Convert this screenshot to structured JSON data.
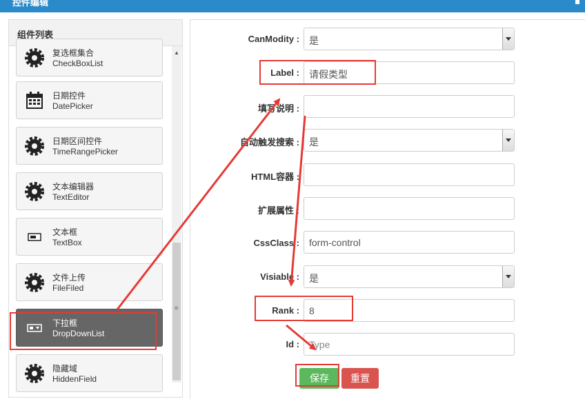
{
  "window": {
    "title": "控件编辑"
  },
  "sidebar": {
    "header": "组件列表",
    "items": [
      {
        "name": "复选框集合",
        "type": "CheckBoxList",
        "icon": "gear-icon"
      },
      {
        "name": "日期控件",
        "type": "DatePicker",
        "icon": "calendar-icon"
      },
      {
        "name": "日期区间控件",
        "type": "TimeRangePicker",
        "icon": "gear-icon"
      },
      {
        "name": "文本编辑器",
        "type": "TextEditor",
        "icon": "gear-icon"
      },
      {
        "name": "文本框",
        "type": "TextBox",
        "icon": "textbox-icon"
      },
      {
        "name": "文件上传",
        "type": "FileFiled",
        "icon": "gear-icon"
      },
      {
        "name": "下拉框",
        "type": "DropDownList",
        "icon": "dropdown-icon",
        "selected": true
      },
      {
        "name": "隐藏域",
        "type": "HiddenField",
        "icon": "gear-icon"
      }
    ]
  },
  "form": {
    "fields": [
      {
        "label": "CanModity :",
        "value": "是",
        "kind": "select"
      },
      {
        "label": "Label :",
        "value": "请假类型",
        "kind": "input"
      },
      {
        "label": "填写说明 :",
        "value": "",
        "kind": "input"
      },
      {
        "label": "自动触发搜索 :",
        "value": "是",
        "kind": "select"
      },
      {
        "label": "HTML容器 :",
        "value": "",
        "kind": "input"
      },
      {
        "label": "扩展属性 :",
        "value": "",
        "kind": "input"
      },
      {
        "label": "CssClass :",
        "value": "form-control",
        "kind": "input"
      },
      {
        "label": "Visiable :",
        "value": "是",
        "kind": "select"
      },
      {
        "label": "Rank :",
        "value": "8",
        "kind": "input"
      },
      {
        "label": "Id :",
        "value": "Type",
        "kind": "input"
      }
    ],
    "save_label": "保存",
    "reset_label": "重置"
  },
  "colors": {
    "accent": "#2b8ac9",
    "save": "#5cb85c",
    "reset": "#d9534f",
    "highlight": "#e53935"
  }
}
